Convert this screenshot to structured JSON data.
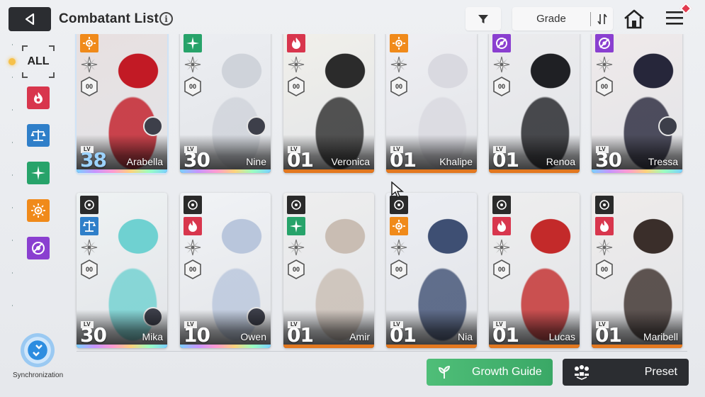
{
  "header": {
    "title": "Combatant List",
    "info_icon": "i",
    "sort_label": "Grade"
  },
  "sidebar": {
    "all_label": "ALL",
    "filters": [
      {
        "name": "fire",
        "color": "#d8364d"
      },
      {
        "name": "balance",
        "color": "#2f7fc9"
      },
      {
        "name": "wind",
        "color": "#27a36a"
      },
      {
        "name": "sun",
        "color": "#f08a1a"
      },
      {
        "name": "void",
        "color": "#8a3fd0"
      }
    ],
    "sync_label": "Synchronization"
  },
  "cards": [
    {
      "name": "Arabella",
      "lv_tag": "LV",
      "level": "38",
      "element": "sun",
      "rank": "00",
      "palette": [
        "#e8e0e0",
        "#c21a25"
      ],
      "selected": true
    },
    {
      "name": "Nine",
      "lv_tag": "LV",
      "level": "30",
      "element": "wind",
      "rank": "00",
      "palette": [
        "#eceef2",
        "#cfd3da"
      ]
    },
    {
      "name": "Veronica",
      "lv_tag": "LV",
      "level": "01",
      "element": "fire",
      "rank": "00",
      "palette": [
        "#f1f0ea",
        "#2b2b2b"
      ]
    },
    {
      "name": "Khalipe",
      "lv_tag": "LV",
      "level": "01",
      "element": "sun",
      "rank": "00",
      "palette": [
        "#efeff3",
        "#d9d9e0"
      ]
    },
    {
      "name": "Renoa",
      "lv_tag": "LV",
      "level": "01",
      "element": "void",
      "rank": "00",
      "palette": [
        "#ececee",
        "#1f2024"
      ]
    },
    {
      "name": "Tressa",
      "lv_tag": "LV",
      "level": "30",
      "element": "void",
      "rank": "00",
      "palette": [
        "#f0eaea",
        "#26263a"
      ]
    },
    {
      "name": "Mika",
      "lv_tag": "LV",
      "level": "30",
      "element": "balance",
      "rank": "00",
      "palette": [
        "#eef2f3",
        "#6fd1d1"
      ]
    },
    {
      "name": "Owen",
      "lv_tag": "LV",
      "level": "10",
      "element": "fire",
      "rank": "00",
      "palette": [
        "#f1f3f6",
        "#b9c6dc"
      ]
    },
    {
      "name": "Amir",
      "lv_tag": "LV",
      "level": "01",
      "element": "wind",
      "rank": "00",
      "palette": [
        "#eeeeee",
        "#c9bdb3"
      ]
    },
    {
      "name": "Nia",
      "lv_tag": "LV",
      "level": "01",
      "element": "sun",
      "rank": "00",
      "palette": [
        "#eceef3",
        "#3e4f73"
      ]
    },
    {
      "name": "Lucas",
      "lv_tag": "LV",
      "level": "01",
      "element": "fire",
      "rank": "00",
      "palette": [
        "#eeeeee",
        "#c32a2a"
      ]
    },
    {
      "name": "Maribell",
      "lv_tag": "LV",
      "level": "01",
      "element": "fire",
      "rank": "00",
      "palette": [
        "#efeceb",
        "#3a2e2a"
      ]
    }
  ],
  "footer": {
    "growth_label": "Growth Guide",
    "preset_label": "Preset"
  },
  "colors": {
    "fire": "#d8364d",
    "balance": "#2f7fc9",
    "wind": "#27a36a",
    "sun": "#f08a1a",
    "void": "#8a3fd0"
  }
}
